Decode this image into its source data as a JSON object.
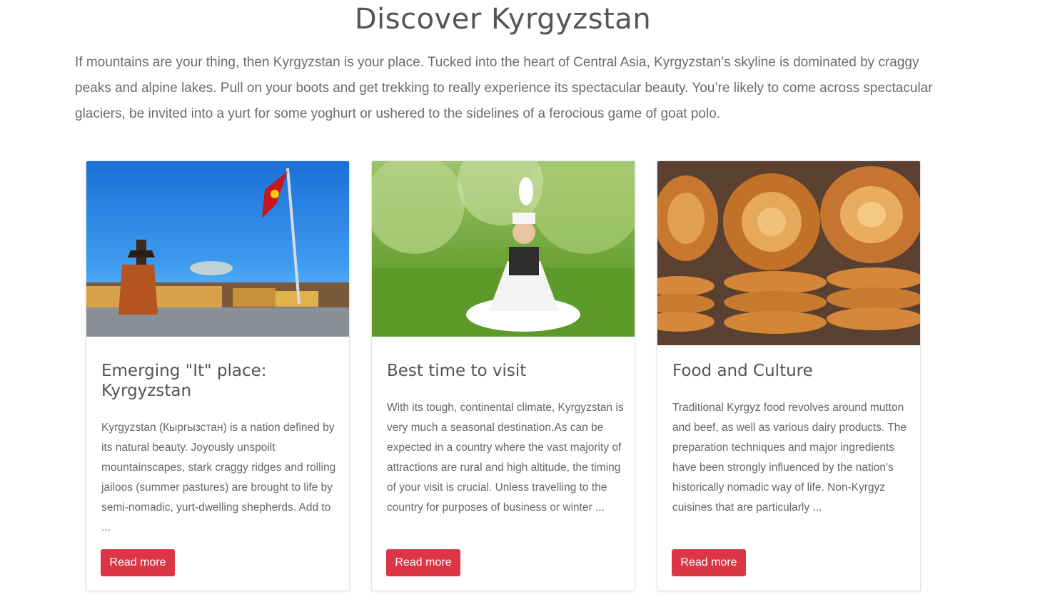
{
  "page": {
    "title": "Discover Kyrgyzstan",
    "intro": "If mountains are your thing, then Kyrgyzstan is your place. Tucked into the heart of Central Asia, Kyrgyzstan’s skyline is dominated by craggy peaks and alpine lakes. Pull on your boots and get trekking to really experience its spectacular beauty. You’re likely to come across spectacular glaciers, be invited into a yurt for some yoghurt or ushered to the sidelines of a ferocious game of goat polo."
  },
  "cards": [
    {
      "image": "city-square-with-flag-and-monument-photo",
      "title": "Emerging \"It\" place: Kyrgyzstan",
      "text": "Kyrgyzstan (Кыргызстан) is a nation defined by its natural beauty. Joyously unspoilt mountainscapes, stark craggy ridges and rolling jailoos (summer pastures) are brought to life by semi-nomadic, yurt-dwelling shepherds. Add to ...",
      "button": "Read more"
    },
    {
      "image": "woman-in-traditional-dress-on-grass-photo",
      "title": "Best time to visit",
      "text": "With its tough, continental climate, Kyrgyzstan is very much a seasonal destination.As can be expected in a country where the vast majority of attractions are rural and high altitude, the timing of your visit is crucial. Unless travelling to the country for purposes of business or winter ...",
      "button": "Read more"
    },
    {
      "image": "stacked-flatbread-photo",
      "title": "Food and Culture",
      "text": "Traditional Kyrgyz food revolves around mutton and beef, as well as various dairy products. The preparation techniques and major ingredients have been strongly influenced by the nation's historically nomadic way of life. Non-Kyrgyz cuisines that are particularly ...",
      "button": "Read more"
    }
  ],
  "colors": {
    "button": "#dc3545",
    "text": "#555555"
  }
}
